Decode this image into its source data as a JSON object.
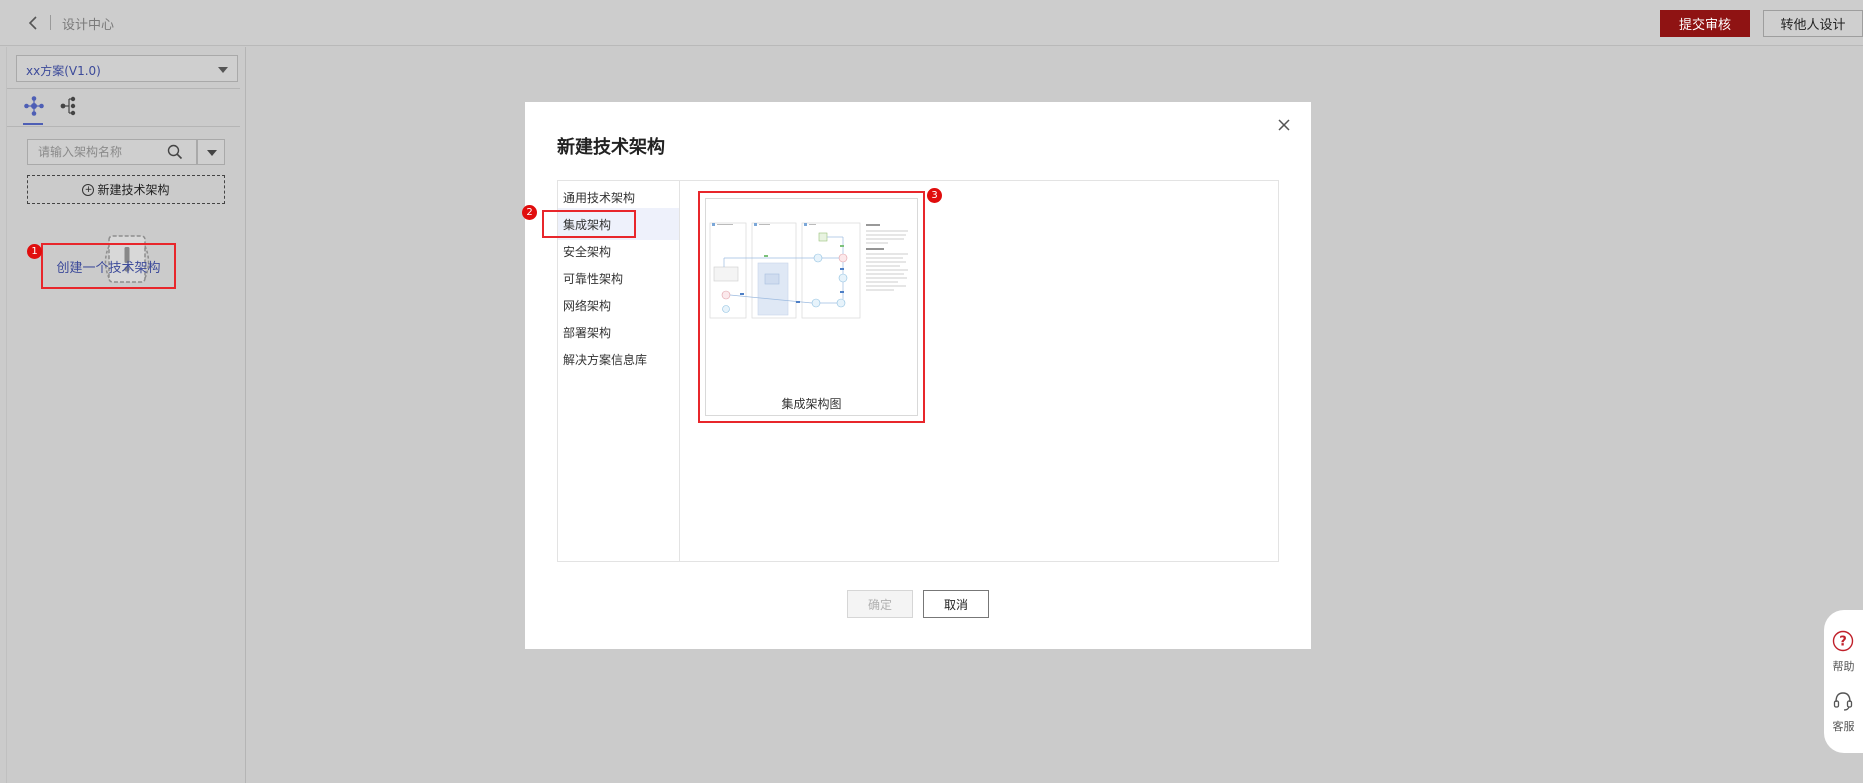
{
  "topbar": {
    "breadcrumb": "设计中心",
    "submit_label": "提交审核",
    "transfer_label": "转他人设计"
  },
  "sidebar": {
    "scheme_select_value": "xx方案(V1.0)",
    "tabs": [
      {
        "icon": "architecture-grid-icon"
      },
      {
        "icon": "tree-structure-icon"
      }
    ],
    "search_placeholder": "请输入架构名称",
    "new_arch_label": "新建技术架构",
    "empty_link": "创建一个技术架构"
  },
  "markers": [
    "1",
    "2",
    "3"
  ],
  "modal": {
    "title": "新建技术架构",
    "categories": [
      "通用技术架构",
      "集成架构",
      "安全架构",
      "可靠性架构",
      "网络架构",
      "部署架构",
      "解决方案信息库"
    ],
    "selected_category": "集成架构",
    "template_card_label": "集成架构图",
    "ok_label": "确定",
    "cancel_label": "取消"
  },
  "float_help": {
    "help_label": "帮助",
    "service_label": "客服"
  },
  "colors": {
    "submit_bg": "#8f1313",
    "marker_red": "#e00d0d",
    "highlight_border": "#e8262b",
    "link_blue": "#3c4a9a"
  }
}
